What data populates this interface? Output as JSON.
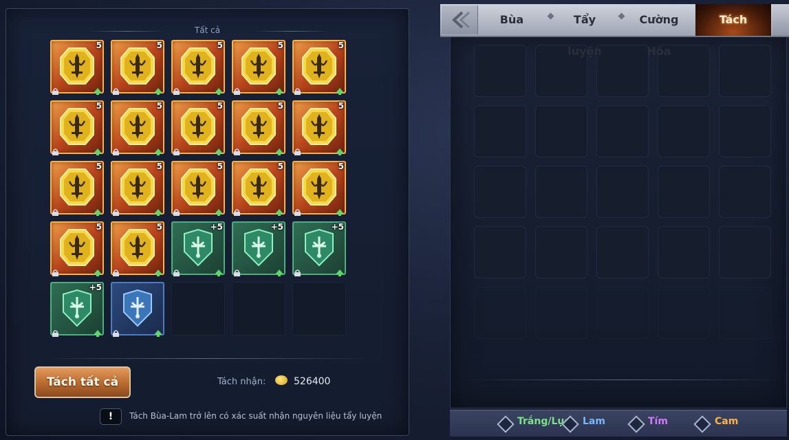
{
  "filter_title": "Tất cả",
  "inventory": [
    {
      "rarity": "orange",
      "plus": "5"
    },
    {
      "rarity": "orange",
      "plus": "5"
    },
    {
      "rarity": "orange",
      "plus": "5"
    },
    {
      "rarity": "orange",
      "plus": "5"
    },
    {
      "rarity": "orange",
      "plus": "5"
    },
    {
      "rarity": "orange",
      "plus": "5"
    },
    {
      "rarity": "orange",
      "plus": "5"
    },
    {
      "rarity": "orange",
      "plus": "5"
    },
    {
      "rarity": "orange",
      "plus": "5"
    },
    {
      "rarity": "orange",
      "plus": "5"
    },
    {
      "rarity": "orange",
      "plus": "5"
    },
    {
      "rarity": "orange",
      "plus": "5"
    },
    {
      "rarity": "orange",
      "plus": "5"
    },
    {
      "rarity": "orange",
      "plus": "5"
    },
    {
      "rarity": "orange",
      "plus": "5"
    },
    {
      "rarity": "orange",
      "plus": "5"
    },
    {
      "rarity": "orange",
      "plus": "5"
    },
    {
      "rarity": "green",
      "plus": "+5"
    },
    {
      "rarity": "green",
      "plus": "+5"
    },
    {
      "rarity": "green",
      "plus": "+5"
    },
    {
      "rarity": "green",
      "plus": "+5"
    },
    {
      "rarity": "blue",
      "plus": ""
    },
    {
      "rarity": "empty",
      "plus": ""
    },
    {
      "rarity": "empty",
      "plus": ""
    },
    {
      "rarity": "empty",
      "plus": ""
    }
  ],
  "split_all_button": "Tách tất cả",
  "earn_label": "Tách nhận:",
  "earn_value": "526400",
  "notice_icon": "!",
  "notice_text": "Tách Bùa-Lam trở lên có xác suất nhận nguyên liệu tẩy luyện",
  "tabs": [
    {
      "label": "Bùa",
      "active": false
    },
    {
      "label": "Tẩy luyện",
      "active": false
    },
    {
      "label": "Cường Hóa",
      "active": false
    },
    {
      "label": "Tách",
      "active": true
    }
  ],
  "legend": [
    {
      "label": "Trắng/Lục",
      "color": "#7ee08a"
    },
    {
      "label": "Lam",
      "color": "#7ab6ff"
    },
    {
      "label": "Tím",
      "color": "#d27aff"
    },
    {
      "label": "Cam",
      "color": "#ffb347"
    }
  ],
  "colors": {
    "orange_frame": "#ffb347",
    "green_frame": "#4fb07e",
    "blue_frame": "#4f7cc0",
    "active_tab": "#a84a1a"
  },
  "icons": {
    "gem_orange": "sword-emblem-icon",
    "gem_green": "shield-emblem-icon",
    "gem_blue": "shield-emblem-icon",
    "lock": "lock-icon",
    "upgrade": "up-arrow-icon",
    "back": "back-arrow-icon",
    "coin": "coin-icon"
  }
}
